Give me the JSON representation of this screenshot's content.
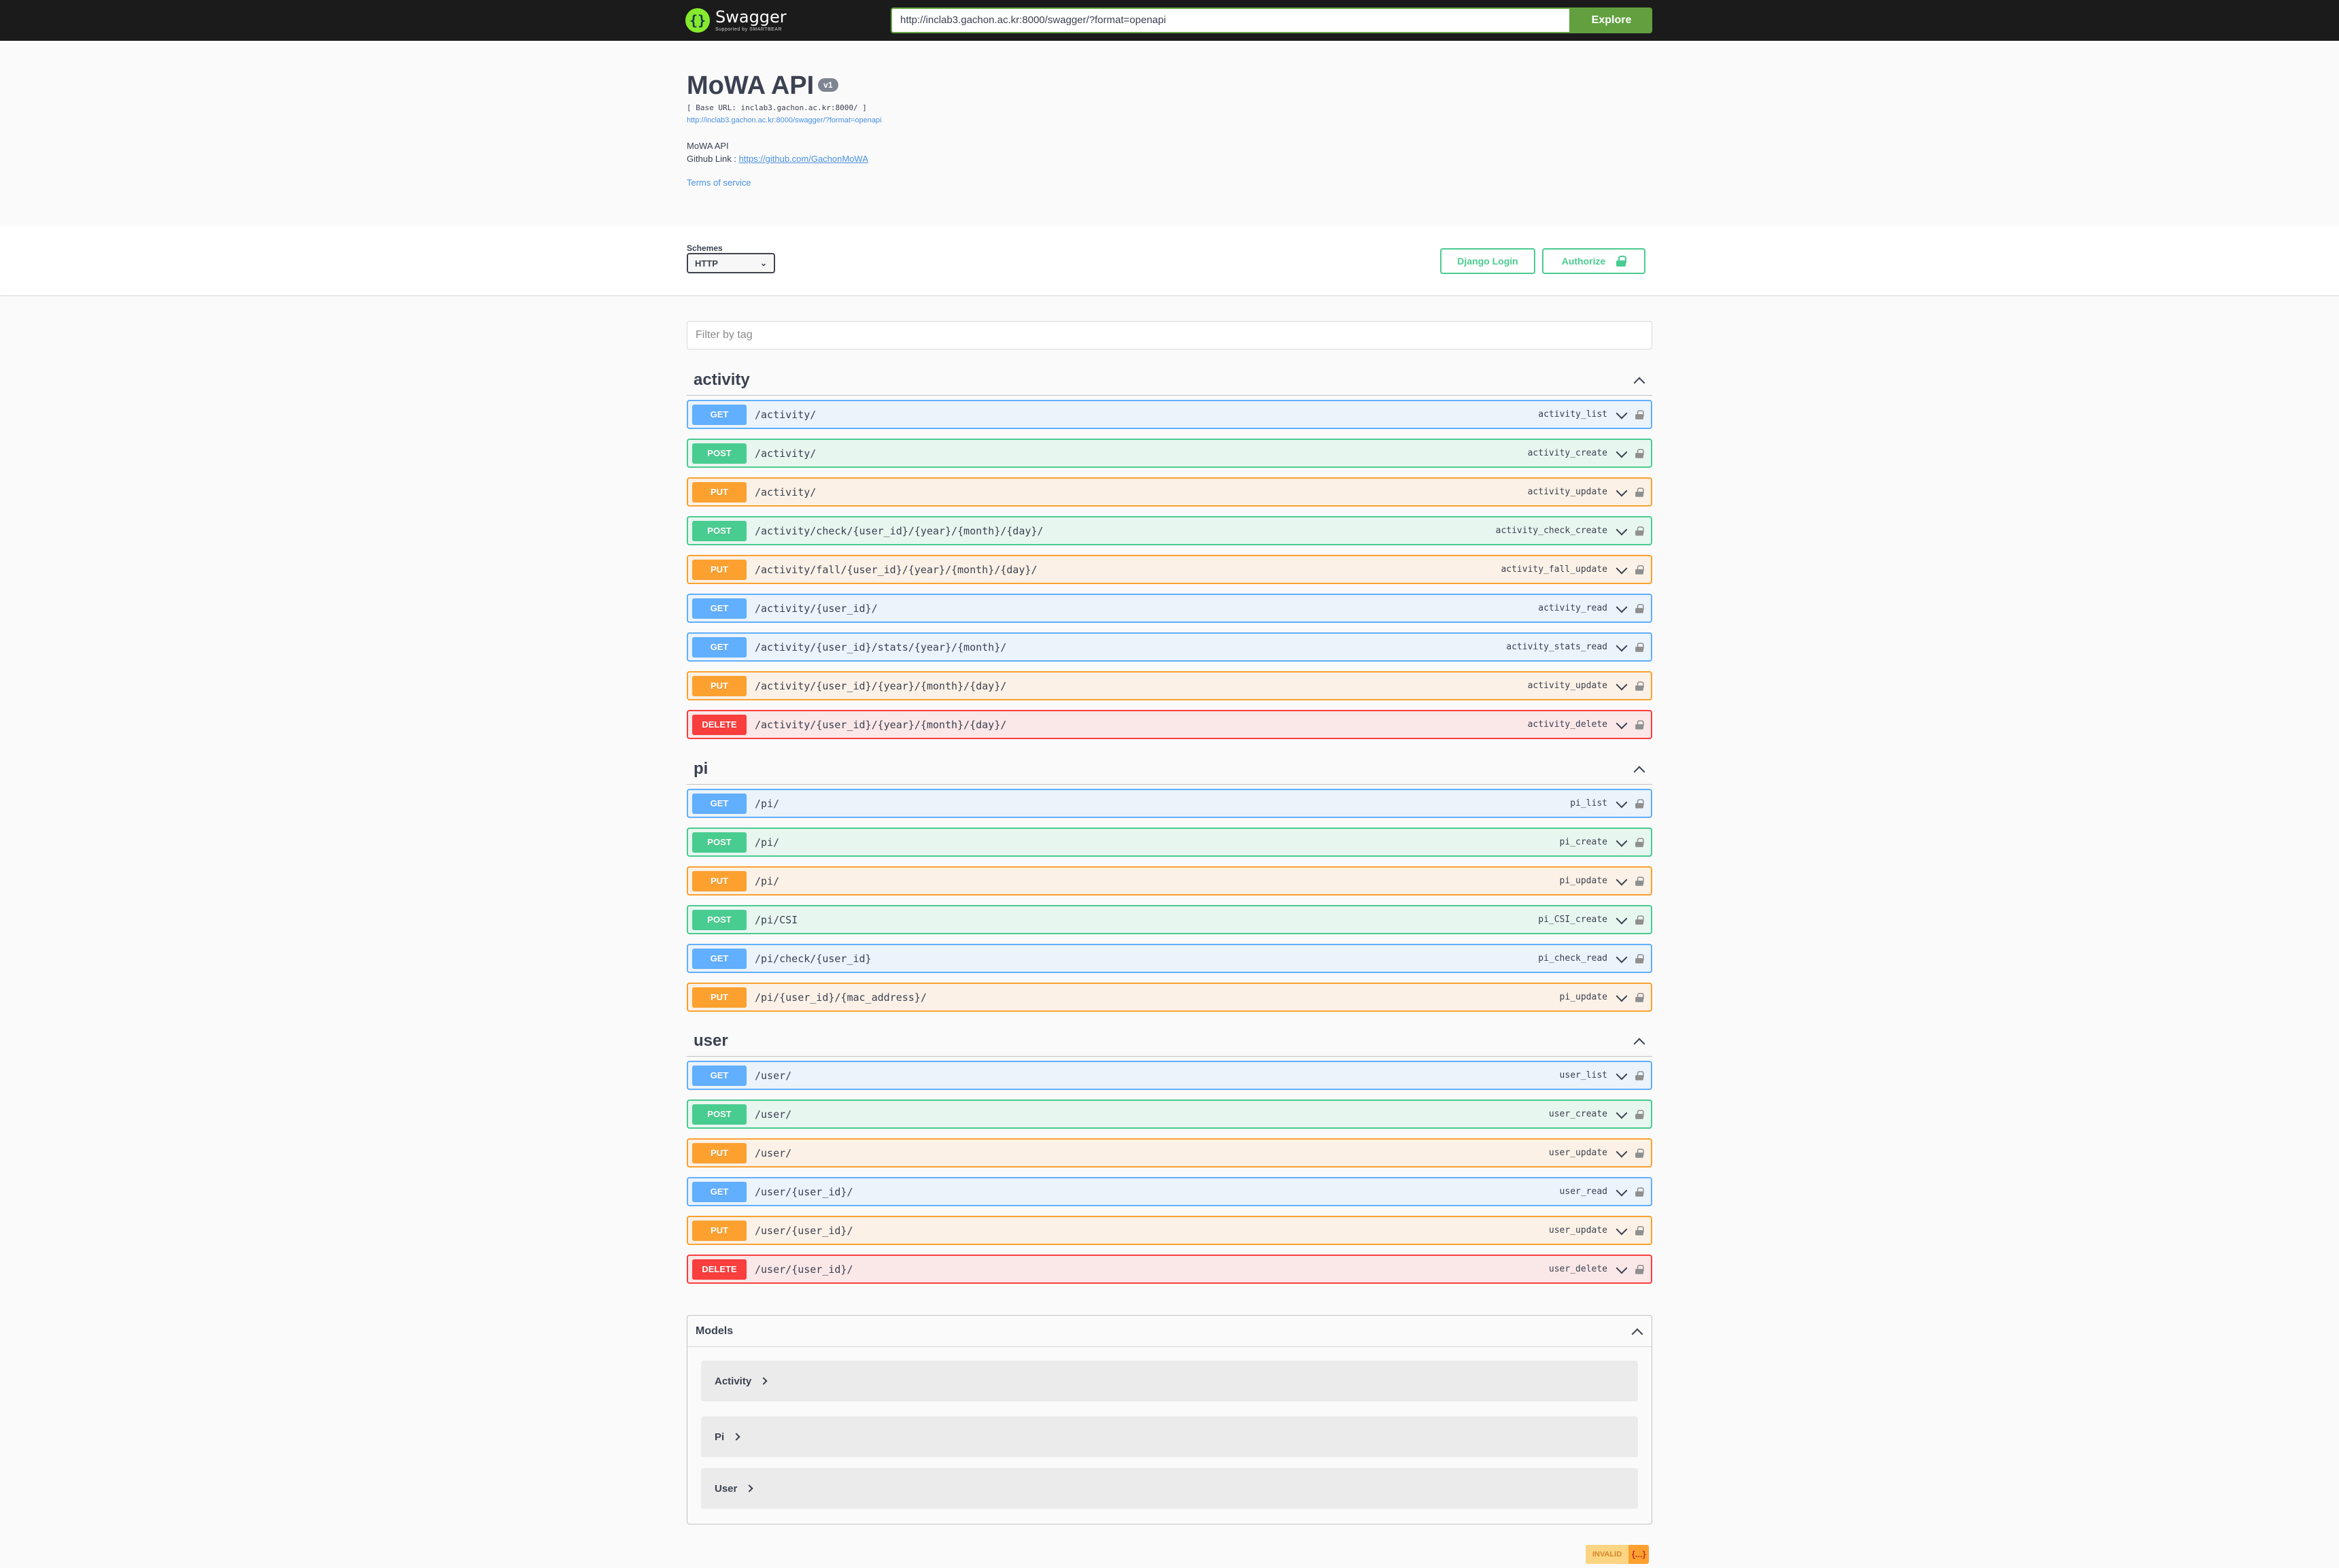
{
  "topbar": {
    "logo_title": "Swagger",
    "logo_sub": "Supported by SMARTBEAR",
    "url": "http://inclab3.gachon.ac.kr:8000/swagger/?format=openapi",
    "explore_label": "Explore"
  },
  "info": {
    "title": "MoWA API",
    "version": "v1",
    "base_url": "[ Base URL: inclab3.gachon.ac.kr:8000/ ]",
    "spec_link": "http://inclab3.gachon.ac.kr:8000/swagger/?format=openapi",
    "description": "MoWA API",
    "github_prefix": "Github Link : ",
    "github_link": "https://github.com/GachonMoWA",
    "terms": "Terms of service"
  },
  "schemes": {
    "label": "Schemes",
    "selected": "HTTP",
    "django_login": "Django Login",
    "authorize": "Authorize"
  },
  "filter": {
    "placeholder": "Filter by tag"
  },
  "tags": [
    {
      "name": "activity",
      "operations": [
        {
          "method": "GET",
          "path": "/activity/",
          "id": "activity_list"
        },
        {
          "method": "POST",
          "path": "/activity/",
          "id": "activity_create"
        },
        {
          "method": "PUT",
          "path": "/activity/",
          "id": "activity_update"
        },
        {
          "method": "POST",
          "path": "/activity/check/{user_id}/{year}/{month}/{day}/",
          "id": "activity_check_create"
        },
        {
          "method": "PUT",
          "path": "/activity/fall/{user_id}/{year}/{month}/{day}/",
          "id": "activity_fall_update"
        },
        {
          "method": "GET",
          "path": "/activity/{user_id}/",
          "id": "activity_read"
        },
        {
          "method": "GET",
          "path": "/activity/{user_id}/stats/{year}/{month}/",
          "id": "activity_stats_read"
        },
        {
          "method": "PUT",
          "path": "/activity/{user_id}/{year}/{month}/{day}/",
          "id": "activity_update"
        },
        {
          "method": "DELETE",
          "path": "/activity/{user_id}/{year}/{month}/{day}/",
          "id": "activity_delete"
        }
      ]
    },
    {
      "name": "pi",
      "operations": [
        {
          "method": "GET",
          "path": "/pi/",
          "id": "pi_list"
        },
        {
          "method": "POST",
          "path": "/pi/",
          "id": "pi_create"
        },
        {
          "method": "PUT",
          "path": "/pi/",
          "id": "pi_update"
        },
        {
          "method": "POST",
          "path": "/pi/CSI",
          "id": "pi_CSI_create"
        },
        {
          "method": "GET",
          "path": "/pi/check/{user_id}",
          "id": "pi_check_read"
        },
        {
          "method": "PUT",
          "path": "/pi/{user_id}/{mac_address}/",
          "id": "pi_update"
        }
      ]
    },
    {
      "name": "user",
      "operations": [
        {
          "method": "GET",
          "path": "/user/",
          "id": "user_list"
        },
        {
          "method": "POST",
          "path": "/user/",
          "id": "user_create"
        },
        {
          "method": "PUT",
          "path": "/user/",
          "id": "user_update"
        },
        {
          "method": "GET",
          "path": "/user/{user_id}/",
          "id": "user_read"
        },
        {
          "method": "PUT",
          "path": "/user/{user_id}/",
          "id": "user_update"
        },
        {
          "method": "DELETE",
          "path": "/user/{user_id}/",
          "id": "user_delete"
        }
      ]
    }
  ],
  "models": {
    "title": "Models",
    "items": [
      "Activity",
      "Pi",
      "User"
    ]
  },
  "validator": {
    "invalid": "INVALID",
    "braces": "{...}"
  },
  "colors": {
    "get": "#61affe",
    "post": "#49cc90",
    "put": "#fca130",
    "delete": "#f93e3e",
    "topbar": "#1b1b1b",
    "explore": "#62a03f"
  }
}
